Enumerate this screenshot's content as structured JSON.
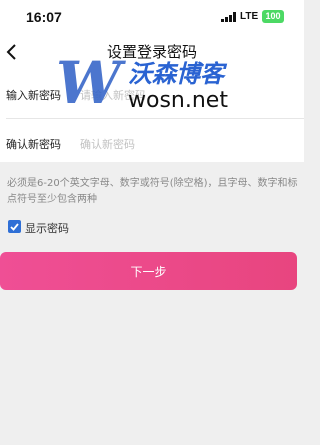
{
  "status_bar": {
    "time": "16:07",
    "network": "LTE",
    "battery": "100"
  },
  "nav": {
    "title": "设置登录密码"
  },
  "form": {
    "new_password": {
      "label": "输入新密码",
      "placeholder": "请输入新密码",
      "value": ""
    },
    "confirm_password": {
      "label": "确认新密码",
      "placeholder": "确认新密码",
      "value": ""
    }
  },
  "hint": "必须是6-20个英文字母、数字或符号(除空格)，且字母、数字和标点符号至少包含两种",
  "show_password": {
    "label": "显示密码",
    "checked": true
  },
  "next_button": {
    "label": "下一步"
  },
  "watermark": {
    "mark": "W",
    "cn": "沃森博客",
    "en": "wosn.net"
  },
  "colors": {
    "accent": "#2f6fd6",
    "button_start": "#ef4f95",
    "button_end": "#e8457f",
    "background": "#efefef"
  }
}
